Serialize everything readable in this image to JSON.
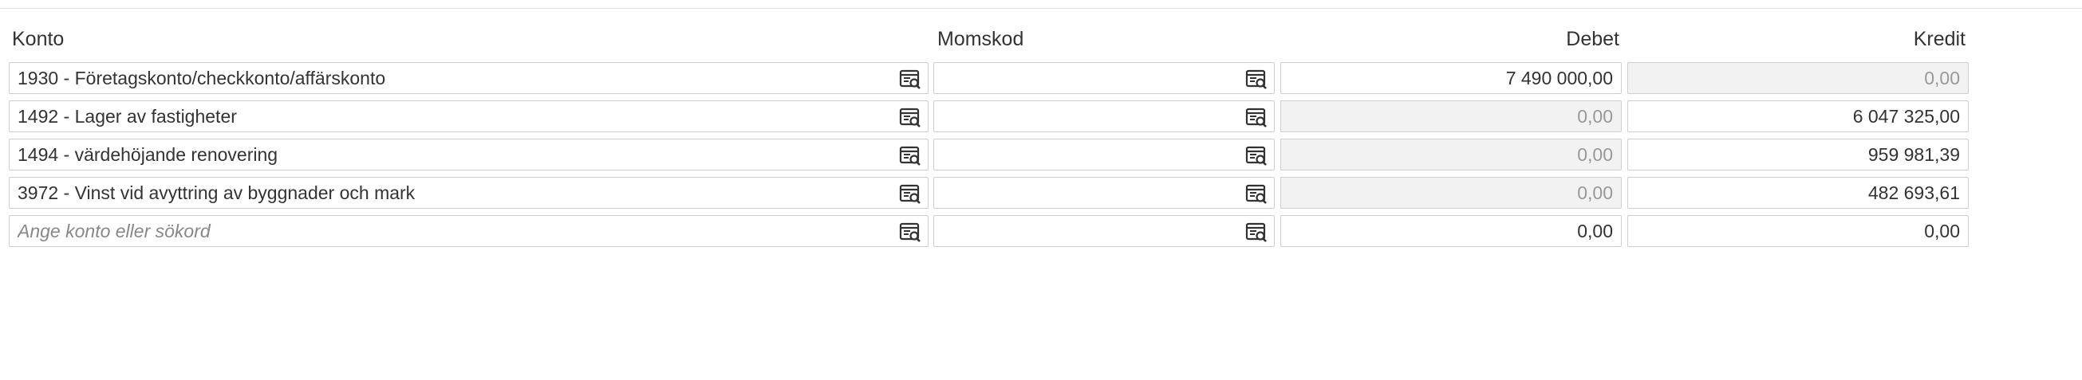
{
  "headers": {
    "konto": "Konto",
    "momskod": "Momskod",
    "debet": "Debet",
    "kredit": "Kredit"
  },
  "konto_placeholder": "Ange konto eller sökord",
  "icons": {
    "lookup": "account-search-icon"
  },
  "colors": {
    "border": "#cfcfcf",
    "disabled_bg": "#f2f2f2",
    "disabled_text": "#999999",
    "text": "#333333"
  },
  "rows": [
    {
      "konto": "1930 - Företagskonto/checkkonto/affärskonto",
      "momskod": "",
      "debet": "7 490 000,00",
      "kredit": "0,00"
    },
    {
      "konto": "1492 - Lager av fastigheter",
      "momskod": "",
      "debet": "0,00",
      "kredit": "6 047 325,00"
    },
    {
      "konto": "1494 - värdehöjande renovering",
      "momskod": "",
      "debet": "0,00",
      "kredit": "959 981,39"
    },
    {
      "konto": "3972 - Vinst vid avyttring av byggnader och mark",
      "momskod": "",
      "debet": "0,00",
      "kredit": "482 693,61"
    },
    {
      "konto": "",
      "momskod": "",
      "debet": "0,00",
      "kredit": "0,00"
    }
  ]
}
